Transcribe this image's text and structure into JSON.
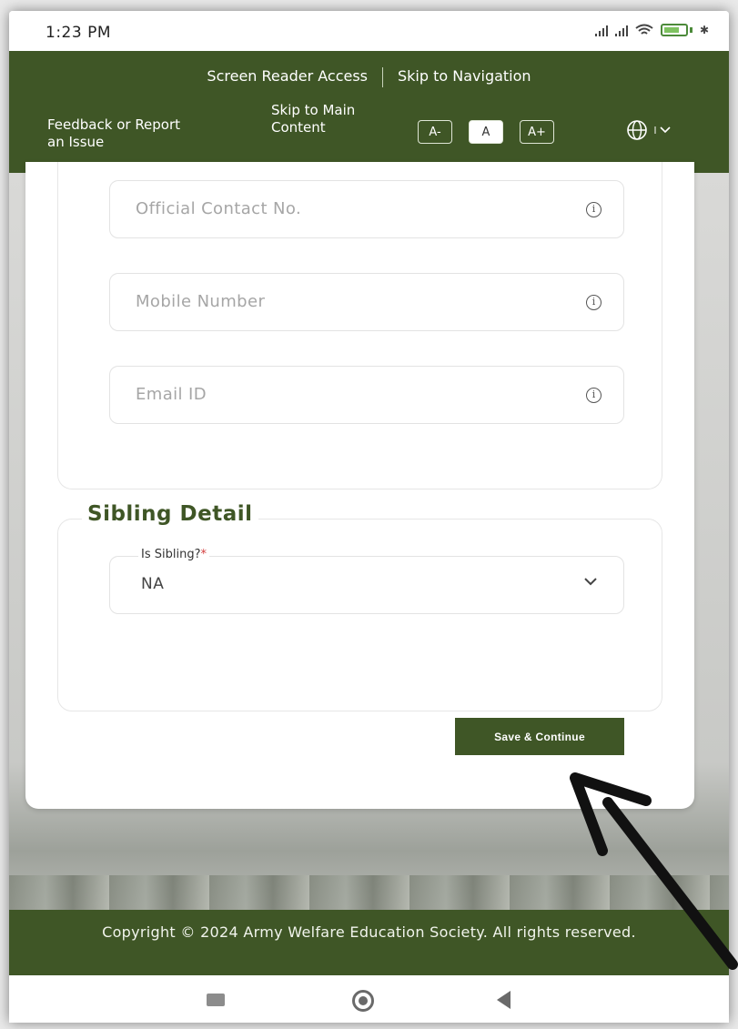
{
  "status_bar": {
    "time": "1:23 PM",
    "battery": "64"
  },
  "access_bar": {
    "screen_reader": "Screen Reader Access",
    "skip_navigation": "Skip to Navigation",
    "feedback": "Feedback or Report an Issue",
    "skip_main": "Skip to Main Content",
    "font_decrease": "A-",
    "font_normal": "A",
    "font_increase": "A+",
    "language_icon": "globe-icon"
  },
  "form": {
    "official_contact_placeholder": "Official Contact No.",
    "mobile_placeholder": "Mobile Number",
    "email_placeholder": "Email ID",
    "sibling_section_title": "Sibling Detail",
    "is_sibling_label": "Is Sibling?",
    "is_sibling_required": "*",
    "is_sibling_value": "NA",
    "save_button": "Save & Continue"
  },
  "footer": {
    "copyright": "Copyright © 2024 Army Welfare Education Society. All rights reserved."
  },
  "colors": {
    "brand_green": "#3f5626",
    "required_red": "#d23c3c"
  }
}
